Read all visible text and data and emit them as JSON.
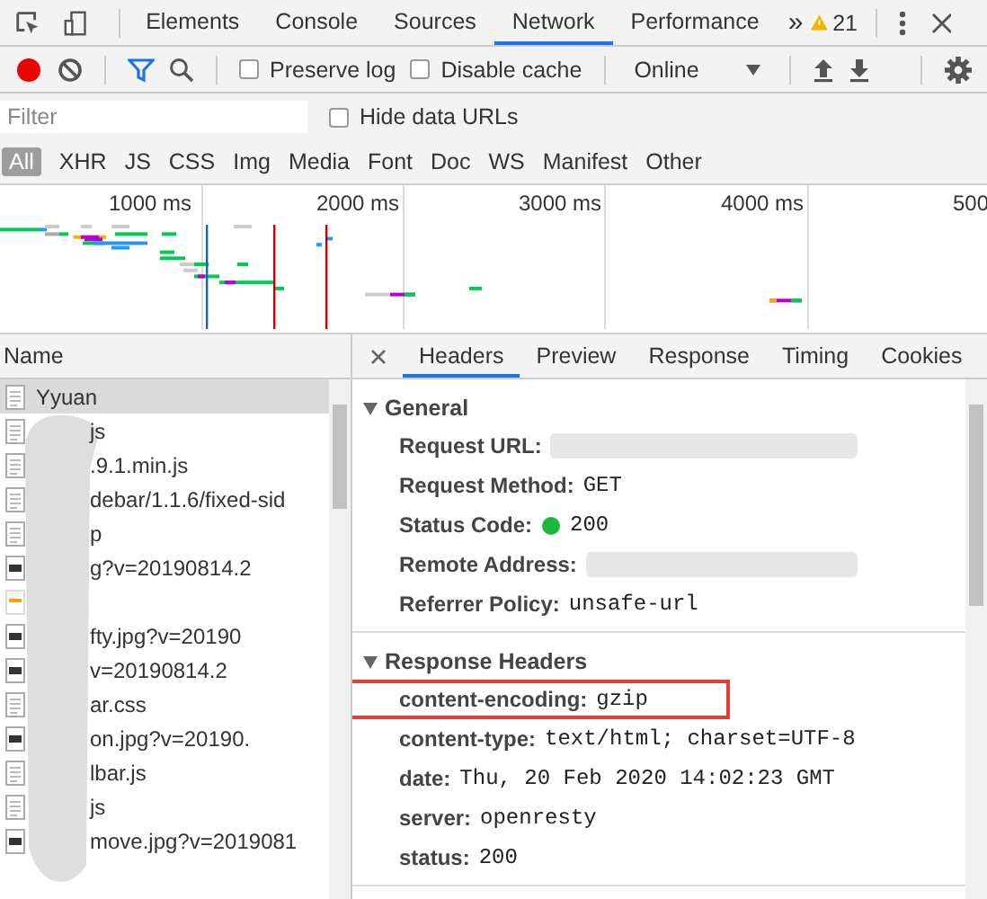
{
  "main_tabs": [
    {
      "label": "Elements",
      "selected": false
    },
    {
      "label": "Console",
      "selected": false
    },
    {
      "label": "Sources",
      "selected": false
    },
    {
      "label": "Network",
      "selected": true
    },
    {
      "label": "Performance",
      "selected": false
    }
  ],
  "overflow": "»",
  "warnings": "21",
  "toolbar": {
    "recording": true,
    "preserve_log": {
      "label": "Preserve log",
      "checked": false
    },
    "disable_cache": {
      "label": "Disable cache",
      "checked": false
    },
    "throttling": "Online"
  },
  "filter": {
    "placeholder": "Filter"
  },
  "hide_data_urls": {
    "label": "Hide data URLs",
    "checked": false
  },
  "type_filters": [
    {
      "label": "All",
      "selected": true
    },
    {
      "label": "XHR",
      "selected": false
    },
    {
      "label": "JS",
      "selected": false
    },
    {
      "label": "CSS",
      "selected": false
    },
    {
      "label": "Img",
      "selected": false
    },
    {
      "label": "Media",
      "selected": false
    },
    {
      "label": "Font",
      "selected": false
    },
    {
      "label": "Doc",
      "selected": false
    },
    {
      "label": "WS",
      "selected": false
    },
    {
      "label": "Manifest",
      "selected": false
    },
    {
      "label": "Other",
      "selected": false
    }
  ],
  "timeline": {
    "ticks": [
      "1000 ms",
      "2000 ms",
      "3000 ms",
      "4000 ms",
      "500"
    ]
  },
  "requests": {
    "header": "Name",
    "rows": [
      {
        "name": "Yyuan",
        "kind": "doc",
        "selected": true
      },
      {
        "name": "js",
        "kind": "doc",
        "selected": false
      },
      {
        "name": ".9.1.min.js",
        "kind": "doc",
        "selected": false
      },
      {
        "name": "debar/1.1.6/fixed-sid",
        "kind": "doc",
        "selected": false
      },
      {
        "name": "p",
        "kind": "doc",
        "selected": false
      },
      {
        "name": "g?v=20190814.2",
        "kind": "image",
        "selected": false
      },
      {
        "kind": "script",
        "selected": false
      },
      {
        "name": "fty.jpg?v=20190",
        "kind": "image",
        "selected": false
      },
      {
        "name": "v=20190814.2",
        "kind": "image",
        "selected": false
      },
      {
        "name": "ar.css",
        "kind": "doc",
        "selected": false
      },
      {
        "name": "on.jpg?v=20190.",
        "kind": "image",
        "selected": false
      },
      {
        "name": "lbar.js",
        "kind": "doc",
        "selected": false
      },
      {
        "name": "js",
        "kind": "doc",
        "selected": false
      },
      {
        "name": "move.jpg?v=2019081",
        "kind": "image",
        "selected": false
      }
    ]
  },
  "details": {
    "tabs": [
      {
        "label": "Headers",
        "selected": true
      },
      {
        "label": "Preview",
        "selected": false
      },
      {
        "label": "Response",
        "selected": false
      },
      {
        "label": "Timing",
        "selected": false
      },
      {
        "label": "Cookies",
        "selected": false
      }
    ],
    "sections": [
      {
        "title": "General",
        "expanded": true,
        "rows": [
          {
            "name": "Request URL:",
            "kind": "redacted"
          },
          {
            "name": "Request Method:",
            "kind": "text",
            "value": "GET"
          },
          {
            "name": "Status Code:",
            "kind": "status",
            "value": "200"
          },
          {
            "name": "Remote Address:",
            "kind": "redacted"
          },
          {
            "name": "Referrer Policy:",
            "kind": "text",
            "value": "unsafe-url"
          }
        ]
      },
      {
        "title": "Response Headers",
        "expanded": true,
        "rows": [
          {
            "name": "content-encoding:",
            "kind": "text",
            "value": "gzip",
            "highlighted": true
          },
          {
            "name": "content-type:",
            "kind": "text",
            "value": "text/html; charset=UTF-8",
            "highlighted": false
          },
          {
            "name": "date:",
            "kind": "text",
            "value": "Thu, 20 Feb 2020 14:02:23 GMT",
            "highlighted": false
          },
          {
            "name": "server:",
            "kind": "text",
            "value": "openresty",
            "highlighted": false
          },
          {
            "name": "status:",
            "kind": "text",
            "value": "200",
            "highlighted": false
          }
        ]
      }
    ]
  }
}
